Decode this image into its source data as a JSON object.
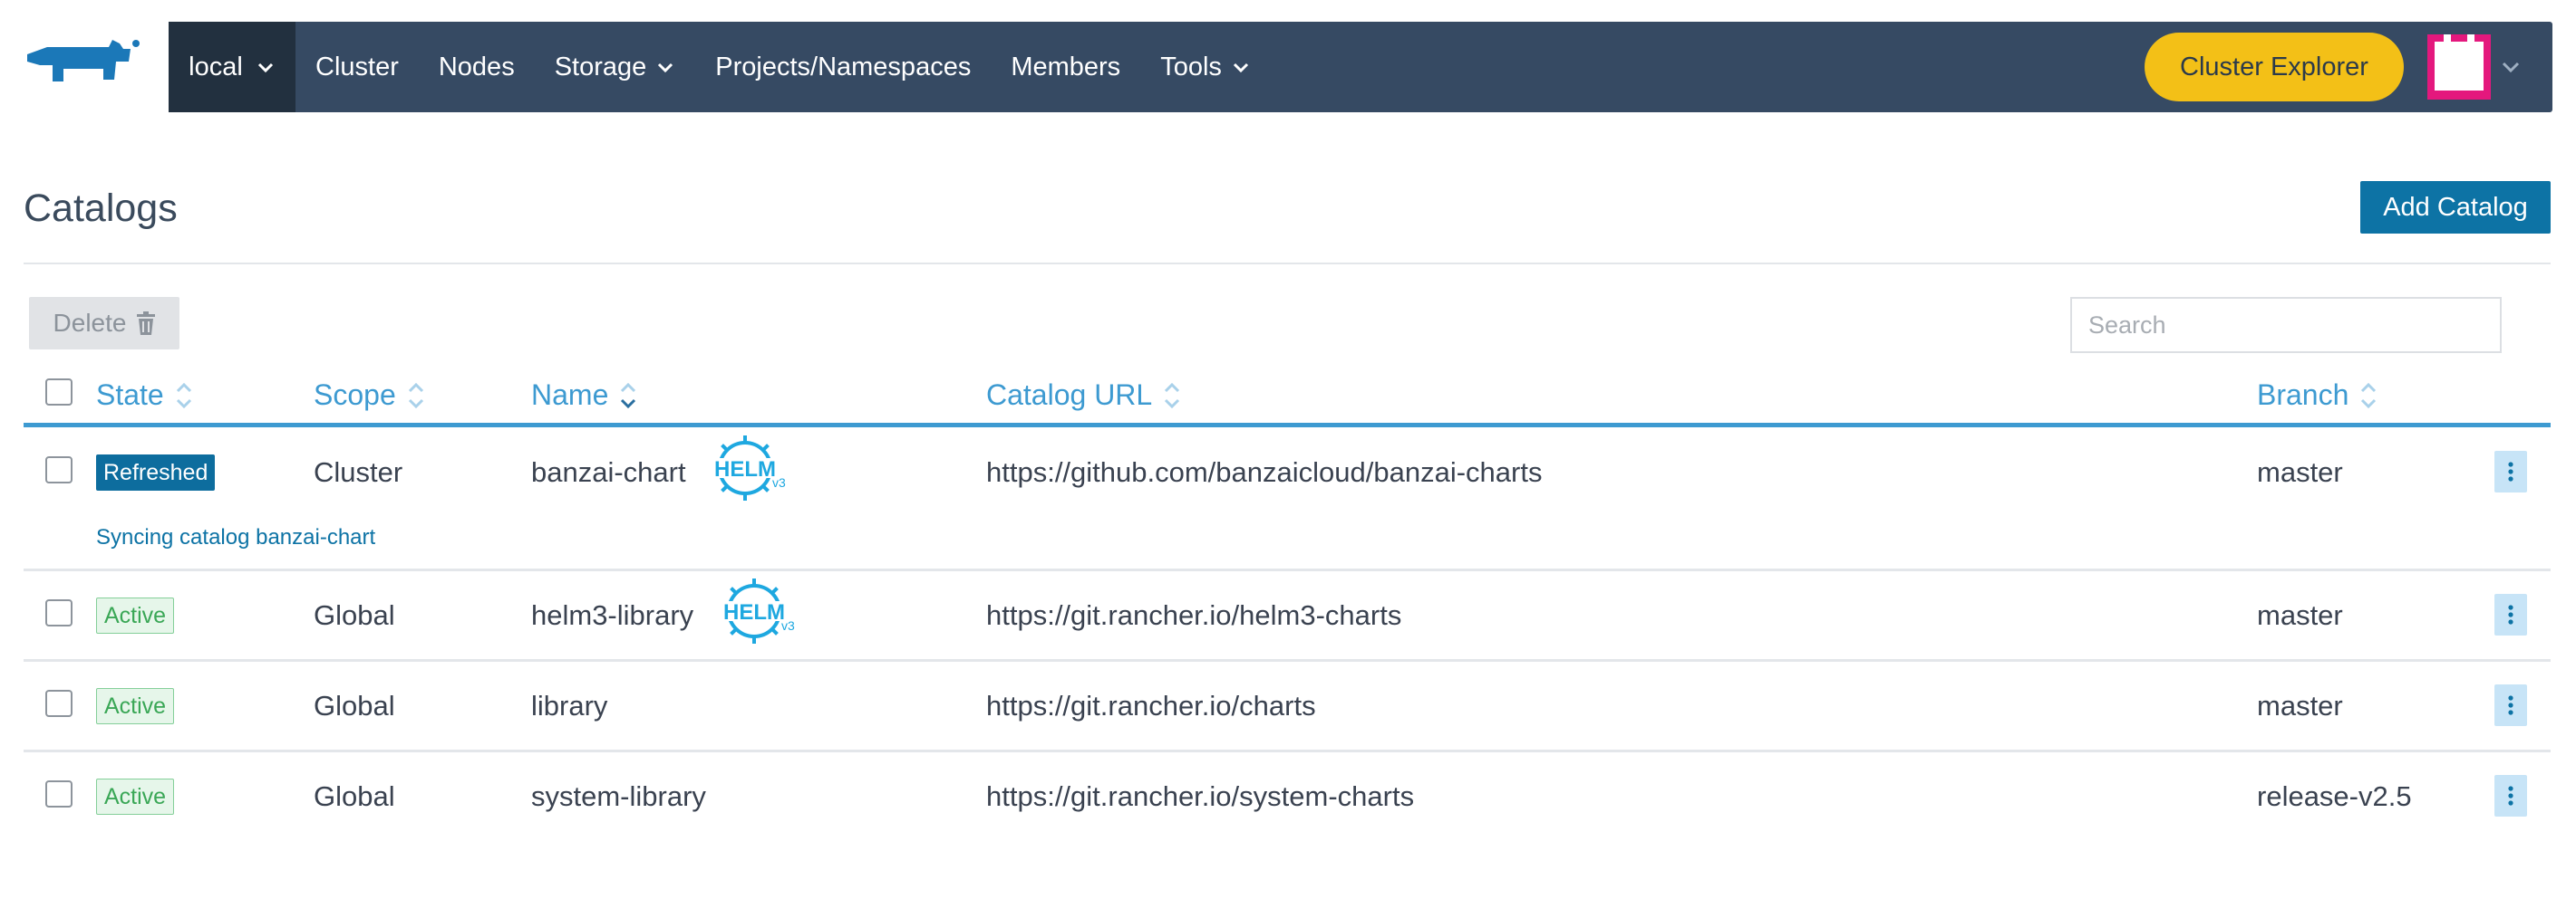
{
  "header": {
    "logo_icon": "rancher-cow-logo",
    "cluster": "local",
    "nav": [
      {
        "label": "Cluster",
        "dropdown": false
      },
      {
        "label": "Nodes",
        "dropdown": false
      },
      {
        "label": "Storage",
        "dropdown": true
      },
      {
        "label": "Projects/Namespaces",
        "dropdown": false
      },
      {
        "label": "Members",
        "dropdown": false
      },
      {
        "label": "Tools",
        "dropdown": true
      }
    ],
    "explorer_button": "Cluster Explorer",
    "avatar_icon": "user-avatar"
  },
  "page": {
    "title": "Catalogs",
    "add_button": "Add Catalog",
    "delete_button": "Delete",
    "search_placeholder": "Search"
  },
  "table": {
    "columns": [
      "State",
      "Scope",
      "Name",
      "Catalog URL",
      "Branch"
    ],
    "rows": [
      {
        "state": "Refreshed",
        "scope": "Cluster",
        "name": "banzai-chart",
        "helm3": true,
        "url": "https://github.com/banzaicloud/banzai-charts",
        "branch": "master",
        "message": "Syncing catalog banzai-chart"
      },
      {
        "state": "Active",
        "scope": "Global",
        "name": "helm3-library",
        "helm3": true,
        "url": "https://git.rancher.io/helm3-charts",
        "branch": "master"
      },
      {
        "state": "Active",
        "scope": "Global",
        "name": "library",
        "helm3": false,
        "url": "https://git.rancher.io/charts",
        "branch": "master"
      },
      {
        "state": "Active",
        "scope": "Global",
        "name": "system-library",
        "helm3": false,
        "url": "https://git.rancher.io/system-charts",
        "branch": "release-v2.5"
      }
    ],
    "helm_badge": {
      "word": "HELM",
      "version": "v3"
    }
  },
  "colors": {
    "topbar": "#364a63",
    "accent": "#3d9ad1",
    "primary_button": "#0d73a5",
    "explorer_button": "#f3c017",
    "active_badge": "#3aa756"
  }
}
